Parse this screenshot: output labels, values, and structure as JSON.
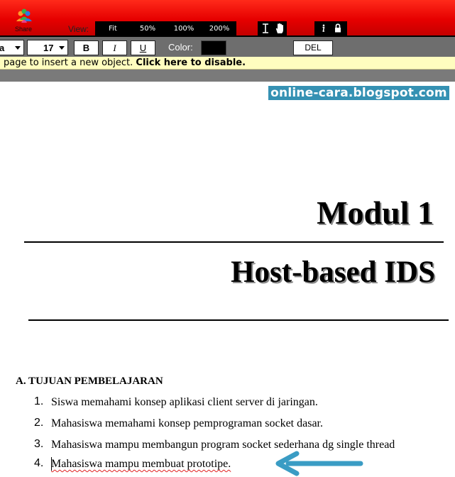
{
  "toolbar": {
    "share_label": "Share",
    "view_label": "View:",
    "zoom_options": [
      "Fit",
      "50%",
      "100%",
      "200%"
    ],
    "tools": [
      "text-cursor-icon",
      "hand-icon"
    ],
    "info_tools": [
      "info-icon",
      "lock-icon"
    ]
  },
  "format": {
    "font_size": "17",
    "bold_label": "B",
    "italic_label": "I",
    "underline_label": "U",
    "color_label": "Color:",
    "current_color": "#000000",
    "delete_label": "DEL"
  },
  "notice": {
    "text": "page to insert a new object.",
    "action": "Click here to disable."
  },
  "document": {
    "watermark": "online-cara.blogspot.com",
    "title": "Modul 1",
    "subtitle": "Host-based IDS",
    "section_heading": "A. TUJUAN PEMBELAJARAN",
    "objectives": [
      {
        "num": "1.",
        "text": "Siswa memahami konsep aplikasi client server di jaringan."
      },
      {
        "num": "2.",
        "text": "Mahasiswa memahami konsep pemprograman socket dasar."
      },
      {
        "num": "3.",
        "text": "Mahasiswa mampu membangun program socket sederhana dg single thread"
      },
      {
        "num": "4.",
        "text": "Mahasiswa mampu membuat prototipe."
      }
    ]
  },
  "colors": {
    "toolbar_red": "#e60000",
    "format_bar_gray": "#6e6e6e",
    "notice_yellow": "#fffdbf",
    "watermark_blue": "#3591b3",
    "arrow_blue": "#3a9cc4",
    "spellcheck_red": "#e02020"
  }
}
